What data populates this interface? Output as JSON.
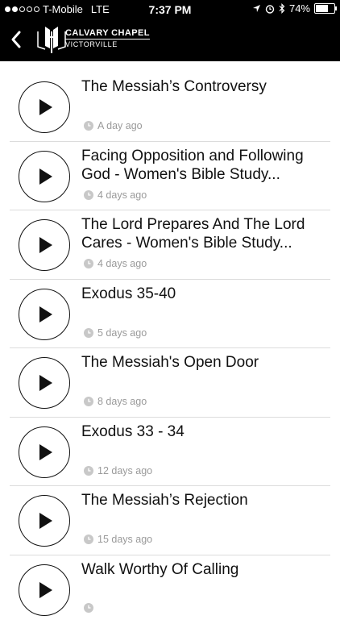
{
  "status_bar": {
    "carrier": "T-Mobile",
    "network": "LTE",
    "time": "7:37 PM",
    "battery": "74%",
    "battery_level": 0.74
  },
  "header": {
    "back_icon": "chevron-left-icon",
    "logo_icon": "church-logo-icon",
    "brand_name": "CALVARY CHAPEL",
    "brand_sub": "VICTORVILLE"
  },
  "sermons": [
    {
      "title": "The Messiah’s Controversy",
      "date": "A day ago"
    },
    {
      "title": "Facing Opposition and Following God - Women's Bible Study...",
      "date": "4 days ago"
    },
    {
      "title": "The Lord Prepares And The Lord Cares - Women's Bible Study...",
      "date": "4 days ago"
    },
    {
      "title": "Exodus 35-40",
      "date": "5 days ago"
    },
    {
      "title": "The Messiah's Open Door",
      "date": "8 days ago"
    },
    {
      "title": "Exodus 33 - 34",
      "date": "12 days ago"
    },
    {
      "title": "The Messiah’s Rejection",
      "date": "15 days ago"
    },
    {
      "title": "Walk Worthy Of Calling",
      "date": ""
    }
  ],
  "colors": {
    "header_bg": "#000000",
    "text": "#111111",
    "meta_text": "#9a9a9a"
  }
}
